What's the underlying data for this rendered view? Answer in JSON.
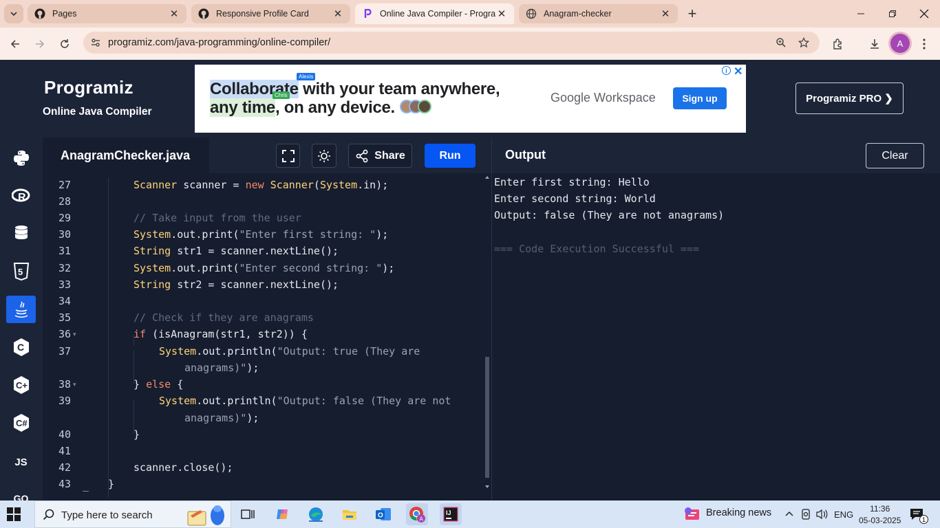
{
  "browser": {
    "tabs": [
      {
        "title": "Pages",
        "icon": "github-icon"
      },
      {
        "title": "Responsive Profile Card",
        "icon": "github-icon"
      },
      {
        "title": "Online Java Compiler - Program",
        "icon": "programiz-icon"
      },
      {
        "title": "Anagram-checker",
        "icon": "globe-icon"
      }
    ],
    "url": "programiz.com/java-programming/online-compiler/",
    "avatar_letter": "A"
  },
  "header": {
    "logo": "Programiz",
    "subtitle": "Online Java Compiler",
    "pro_button": "Programiz PRO ❯"
  },
  "ad": {
    "line1_hl": "Collaborate",
    "line1_rest": " with your team anywhere,",
    "line2_hl": "any time",
    "line2_rest": ", on any device.",
    "tag1": "Alexis",
    "tag2": "Chris",
    "brand": "Google Workspace",
    "signup": "Sign up"
  },
  "sidebar": [
    "python-icon",
    "r-lang-icon",
    "sql-icon",
    "html5-icon",
    "java-icon",
    "c-icon",
    "cpp-icon",
    "csharp-icon",
    "js-icon",
    "go-icon"
  ],
  "sidebar_js": "JS",
  "sidebar_go": "GO",
  "editor": {
    "filename": "AnagramChecker.java",
    "share": "Share",
    "run": "Run"
  },
  "output": {
    "title": "Output",
    "clear": "Clear",
    "lines": [
      "Enter first string: Hello",
      "Enter second string: World",
      "Output: false (They are not anagrams)",
      "",
      "=== Code Execution Successful ==="
    ]
  },
  "code": {
    "line_numbers": [
      "27",
      "28",
      "29",
      "30",
      "31",
      "32",
      "33",
      "34",
      "35",
      "36",
      "37",
      "38",
      "39",
      "40",
      "41",
      "42",
      "43"
    ],
    "lines": [
      "Scanner scanner = new Scanner(System.in);",
      "",
      "// Take input from the user",
      "System.out.print(\"Enter first string: \");",
      "String str1 = scanner.nextLine();",
      "System.out.print(\"Enter second string: \");",
      "String str2 = scanner.nextLine();",
      "",
      "// Check if they are anagrams",
      "if (isAnagram(str1, str2)) {",
      "System.out.println(\"Output: true (They are",
      "anagrams)\");",
      "} else {",
      "System.out.println(\"Output: false (They are not",
      "anagrams)\");",
      "}",
      "",
      "scanner.close();",
      "}"
    ]
  },
  "taskbar": {
    "search_placeholder": "Type here to search",
    "news": "Breaking news",
    "lang": "ENG",
    "time": "11:36",
    "date": "05-03-2025",
    "notifications": "1"
  },
  "colors": {
    "accent": "#0556f3",
    "editor_bg": "#161d2f",
    "panel_bg": "#1c2438",
    "string": "#9aa3b2",
    "keyword": "#f28b6a",
    "type": "#ffd479",
    "comment": "#5f6b80"
  }
}
